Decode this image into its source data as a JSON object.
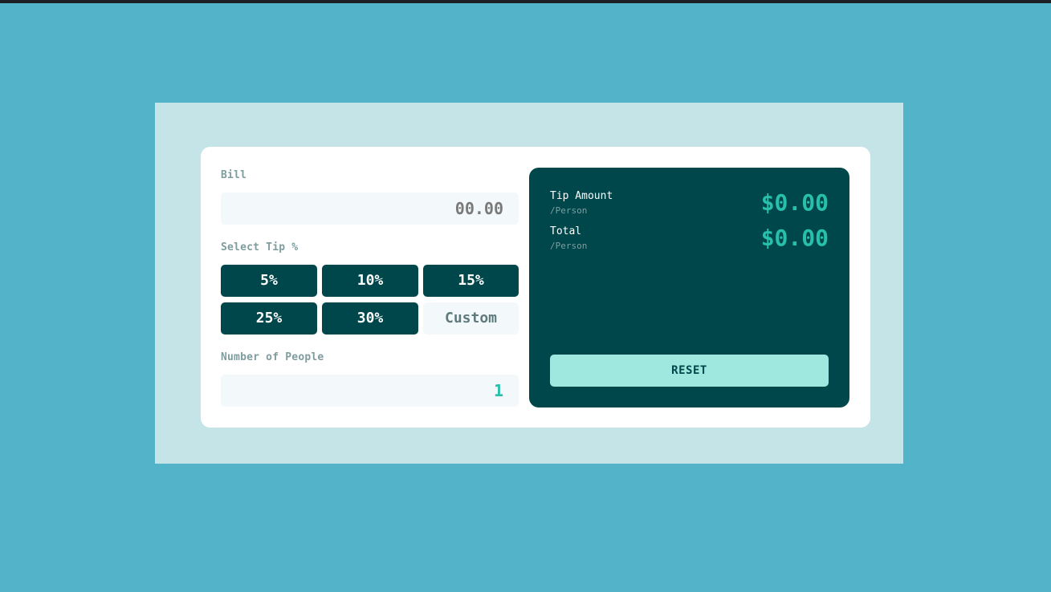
{
  "bill": {
    "label": "Bill",
    "value": "00.00"
  },
  "tip": {
    "label": "Select Tip %",
    "options": [
      "5%",
      "10%",
      "15%",
      "25%",
      "30%"
    ],
    "custom_label": "Custom"
  },
  "people": {
    "label": "Number of People",
    "value": "1"
  },
  "results": {
    "tip_amount": {
      "title": "Tip Amount",
      "sub": "/Person",
      "value": "$0.00"
    },
    "total": {
      "title": "Total",
      "sub": "/Person",
      "value": "$0.00"
    }
  },
  "reset_label": "RESET",
  "colors": {
    "background": "#52b3c9",
    "dark_teal": "#00474b",
    "accent": "#26c0ab",
    "reset_bg": "#9fe8df"
  }
}
